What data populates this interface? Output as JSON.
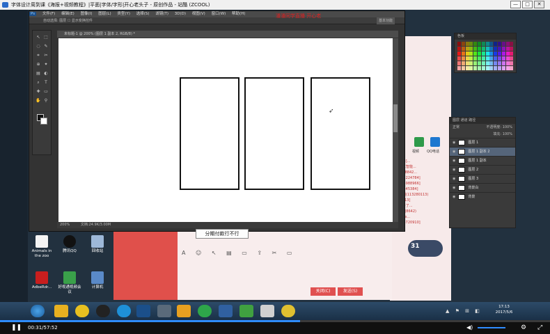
{
  "window": {
    "title": "字体设计周到课《海报+视频教程》|平面|字体/字形|开心老头子 - 原创作品 - 站酷 (ZCOOL)",
    "btn_min": "—",
    "btn_max": "□",
    "btn_close": "✕"
  },
  "overlay": {
    "watermark": "潘潘同学直播  开心老"
  },
  "photoshop": {
    "menu": [
      "Ps",
      "文件(F)",
      "编辑(E)",
      "图像(I)",
      "图层(L)",
      "类型(Y)",
      "选择(S)",
      "滤镜(T)",
      "3D(D)",
      "视图(V)",
      "窗口(W)",
      "帮助(H)"
    ],
    "options_text": "自动选择:  图层  ☐ 显示变换控件",
    "workspace": "基本功能",
    "doc_tab": "未标题-1 @ 200% (图层 1 副本 2, RGB/8) *",
    "status_zoom": "200%",
    "status_doc": "文档:24.9K/3.00M",
    "layers_header": [
      "图层",
      "通道",
      "路径"
    ],
    "layers": [
      "图层 1",
      "图层 1 副本 2",
      "图层 1 副本",
      "图层 2",
      "图层 3",
      "背景白",
      "背景"
    ],
    "blend_mode": "正常",
    "opacity": "不透明度: 100%",
    "fill": "填充: 100%"
  },
  "desktop_icons": [
    {
      "label": "Animals in the zoo"
    },
    {
      "label": "腾讯QQ"
    },
    {
      "label": "回收站"
    },
    {
      "label": "AdbeRdr..."
    },
    {
      "label": "好视通视频会议"
    },
    {
      "label": "计算机"
    }
  ],
  "tooltip": "分期付款行不行",
  "chat": {
    "lines": [
      "[2013]...",
      "【人工智能...",
      "【CS(8842...",
      "[8862224784]",
      "[1034988966]",
      "[293345384]",
      "...高期(113280113)",
      "...[2013]",
      "...课好了...",
      "CSCS(8642)",
      "...Lens...",
      "[1033720910]",
      "..."
    ],
    "bottom_buttons": [
      "关闭(C)",
      "发送(S)"
    ],
    "bubble_value": "31",
    "call_label": "QQ电话",
    "video_label": "视频"
  },
  "taskbar": {
    "time": "17:13",
    "date": "2017/5/6"
  },
  "video": {
    "timecode": "00:31/57:52",
    "progress": 0.545
  },
  "colors": {
    "swatch_red": "#e02020",
    "chat_pink": "#f8eded",
    "progress_blue": "#2f8cff"
  }
}
